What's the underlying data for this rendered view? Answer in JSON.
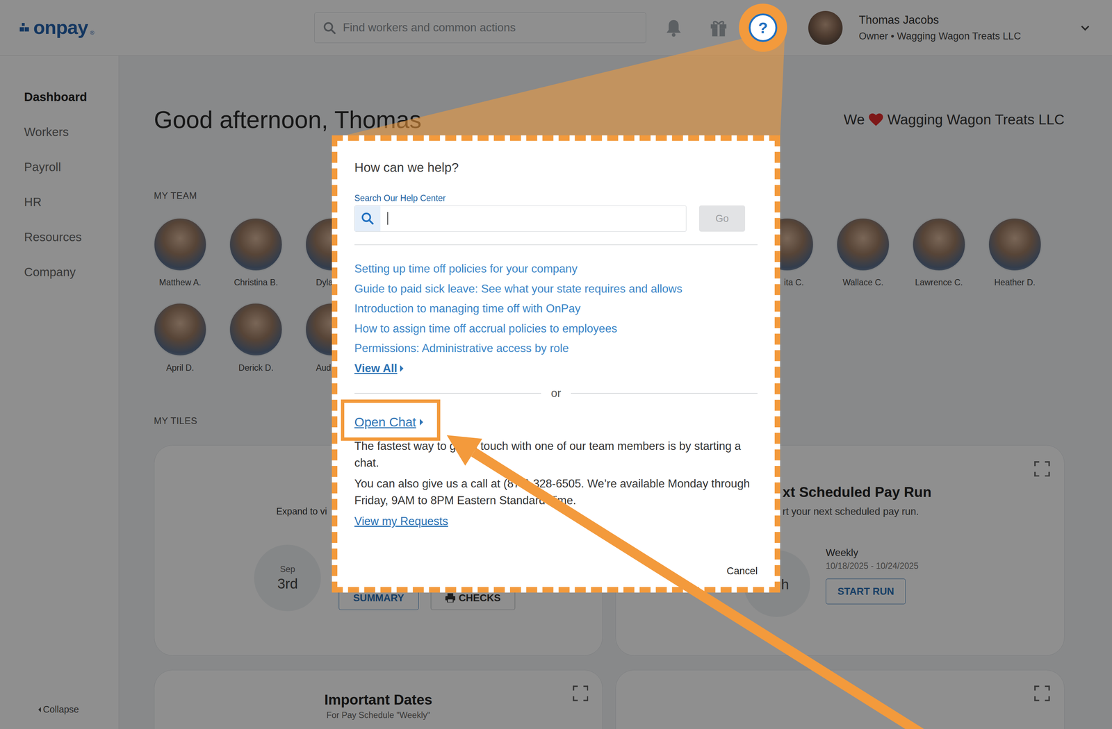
{
  "header": {
    "logo": "onpay",
    "logo_mark": "®",
    "search": {
      "placeholder": "Find workers and common actions"
    },
    "help_icon": "?",
    "user": {
      "name": "Thomas Jacobs",
      "role": "Owner • Wagging Wagon Treats LLC"
    }
  },
  "sidebar": {
    "items": [
      {
        "label": "Dashboard",
        "selected": true
      },
      {
        "label": "Workers",
        "selected": false
      },
      {
        "label": "Payroll",
        "selected": false
      },
      {
        "label": "HR",
        "selected": false
      },
      {
        "label": "Resources",
        "selected": false
      },
      {
        "label": "Company",
        "selected": false
      }
    ],
    "collapse": "Collapse"
  },
  "greeting": "Good afternoon, Thomas",
  "company_banner": {
    "prefix": "We",
    "company": "Wagging Wagon Treats LLC"
  },
  "team": {
    "title": "MY TEAM",
    "rows": [
      {
        "left": [
          "Matthew A.",
          "Christina B.",
          "Dyla"
        ],
        "right": [
          "ita C.",
          "Wallace C.",
          "Lawrence C.",
          "Heather D."
        ]
      },
      {
        "left": [
          "April D.",
          "Derick D.",
          "Aud"
        ],
        "right": []
      }
    ]
  },
  "tiles": {
    "title": "MY TILES",
    "last_pay_run": {
      "text": "Expand to vi",
      "month": "Sep",
      "day": "3rd",
      "buttons": [
        "SUMMARY",
        "CHECKS"
      ]
    },
    "next_pay_run": {
      "title": "xt Scheduled Pay Run",
      "subtitle": "rt your next scheduled pay run.",
      "day": "h",
      "schedule": "Weekly",
      "period": "10/18/2025 - 10/24/2025",
      "button": "START RUN"
    },
    "important_dates": {
      "title": "Important Dates",
      "subtitle": "For Pay Schedule \"Weekly\""
    }
  },
  "help_dialog": {
    "title": "How can we help?",
    "search_label": "Search Our Help Center",
    "go_button": {
      "label": "Go",
      "disabled": true
    },
    "articles": [
      "Setting up time off policies for your company",
      "Guide to paid sick leave: See what your state requires and allows",
      "Introduction to managing time off with OnPay",
      "How to assign time off accrual policies to employees",
      "Permissions: Administrative access by role"
    ],
    "view_all": "View All",
    "divider": "or",
    "open_chat": "Open Chat",
    "chat_text": "The fastest way to get in touch with one of our team members is by starting a chat.",
    "call_text": "You can also give us a call at (877) 328-6505. We’re available Monday through Friday, 9AM to 8PM Eastern Standard Time.",
    "requests": "View my Requests",
    "cancel": "Cancel"
  }
}
